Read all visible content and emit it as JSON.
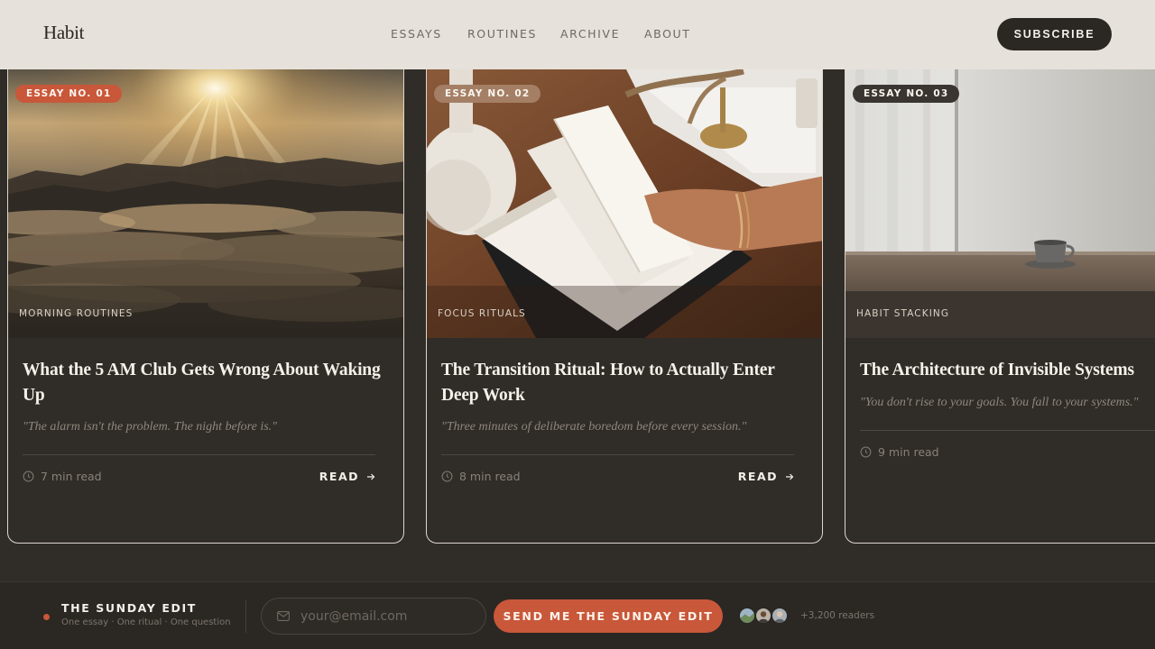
{
  "header": {
    "logo": "Habit",
    "nav": [
      "ESSAYS",
      "ROUTINES",
      "ARCHIVE",
      "ABOUT"
    ],
    "subscribe_label": "SUBSCRIBE"
  },
  "cards": [
    {
      "badge": "ESSAY NO. 01",
      "category": "MORNING ROUTINES",
      "title": "What the 5 AM Club Gets Wrong About Waking Up",
      "quote": "\"The alarm isn't the problem. The night before is.\"",
      "read_time": "7 min read",
      "read_label": "READ"
    },
    {
      "badge": "ESSAY NO. 02",
      "category": "FOCUS RITUALS",
      "title": "The Transition Ritual: How to Actually Enter Deep Work",
      "quote": "\"Three minutes of deliberate boredom before every session.\"",
      "read_time": "8 min read",
      "read_label": "READ"
    },
    {
      "badge": "ESSAY NO. 03",
      "category": "HABIT STACKING",
      "title": "The Architecture of Invisible Systems",
      "quote": "\"You don't rise to your goals. You fall to your systems.\"",
      "read_time": "9 min read"
    }
  ],
  "newsletter": {
    "title": "THE SUNDAY EDIT",
    "subtitle": "One essay · One ritual · One question",
    "email_placeholder": "your@email.com",
    "button_label": "SEND ME THE SUNDAY EDIT",
    "readers": "+3,200 readers"
  },
  "colors": {
    "accent": "#c9573a",
    "header_bg": "#e6e1da",
    "page_bg": "#302c28",
    "badge_2": "#a47f66"
  }
}
